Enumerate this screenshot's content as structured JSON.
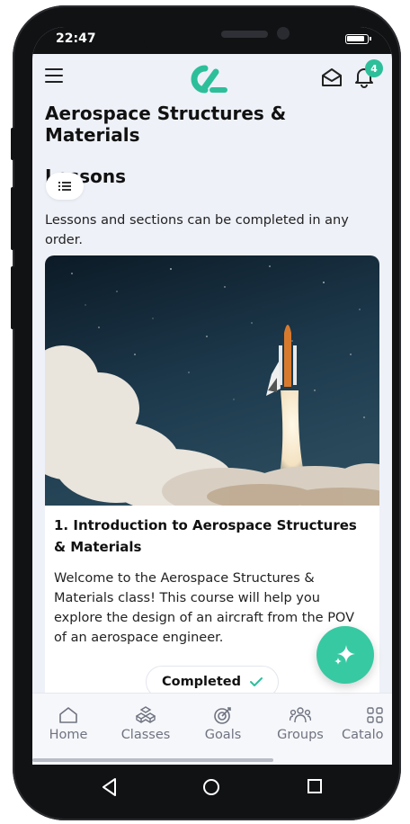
{
  "status_bar": {
    "time": "22:47"
  },
  "header": {
    "notification_count": "4"
  },
  "page": {
    "course_title": "Aerospace Structures & Materials",
    "section_title": "Lessons",
    "info_text": "Lessons and sections can be completed in any order."
  },
  "lesson": {
    "title": "1. Introduction to Aerospace Structures & Materials",
    "description": "Welcome to the Aerospace Structures & Materials class! This course will help you explore the design of an aircraft from the POV of an aerospace engineer.",
    "status": "Completed"
  },
  "bottom_nav": {
    "items": [
      {
        "label": "Home",
        "icon": "home-icon"
      },
      {
        "label": "Classes",
        "icon": "classes-icon"
      },
      {
        "label": "Goals",
        "icon": "goals-icon"
      },
      {
        "label": "Groups",
        "icon": "groups-icon"
      },
      {
        "label": "Catalo",
        "icon": "catalog-icon"
      }
    ]
  },
  "colors": {
    "accent": "#2dbf9a",
    "fab": "#37c9a2",
    "background": "#eef1f8"
  }
}
